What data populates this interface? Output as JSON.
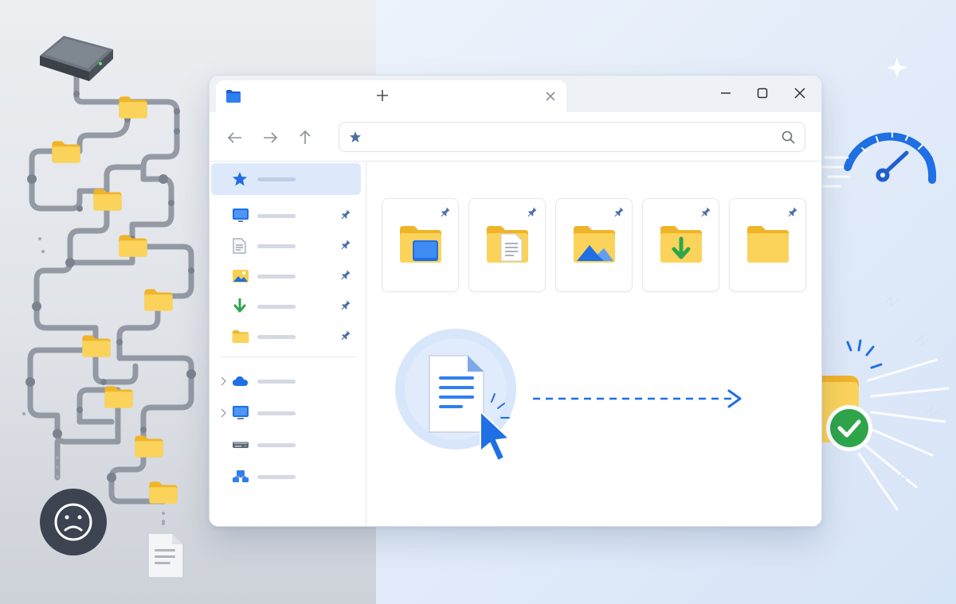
{
  "window": {
    "tab": {
      "icon": "folder-icon"
    },
    "controls": [
      "minimize-icon",
      "maximize-icon",
      "close-icon"
    ],
    "navigation": [
      "back-arrow-icon",
      "forward-arrow-icon",
      "up-arrow-icon"
    ],
    "address_bar": {
      "value": "",
      "leading_icon": "star-icon",
      "trailing_icon": "search-icon"
    }
  },
  "sidebar": {
    "quick_access": [
      {
        "icon": "star-icon",
        "active": true
      },
      {
        "icon": "desktop-icon",
        "pinned": true
      },
      {
        "icon": "document-icon",
        "pinned": true
      },
      {
        "icon": "pictures-icon",
        "pinned": true
      },
      {
        "icon": "downloads-icon",
        "pinned": true
      },
      {
        "icon": "folder-icon",
        "pinned": true
      }
    ],
    "locations": [
      {
        "icon": "cloud-icon",
        "expandable": true
      },
      {
        "icon": "this-pc-icon",
        "expandable": true
      },
      {
        "icon": "drive-icon"
      },
      {
        "icon": "network-icon"
      }
    ]
  },
  "pinned_folders": [
    {
      "icon": "desktop-folder-icon",
      "pinned": true
    },
    {
      "icon": "documents-folder-icon",
      "pinned": true
    },
    {
      "icon": "pictures-folder-icon",
      "pinned": true
    },
    {
      "icon": "downloads-folder-icon",
      "pinned": true
    },
    {
      "icon": "folder-icon",
      "pinned": true
    }
  ],
  "illustration": {
    "left": [
      "hard-drive-icon",
      "folder-maze",
      "sad-face-icon",
      "document-icon"
    ],
    "transfer": [
      "document-icon",
      "cursor-icon",
      "dashed-arrow",
      "folder-icon",
      "checkmark-icon"
    ],
    "right": [
      "speedometer-icon",
      "sparkle-icon"
    ]
  },
  "colors": {
    "accent": "#1e6fe0",
    "folder": "#f9cf4f",
    "success": "#2fa54a",
    "sad_badge": "#3d4350"
  }
}
